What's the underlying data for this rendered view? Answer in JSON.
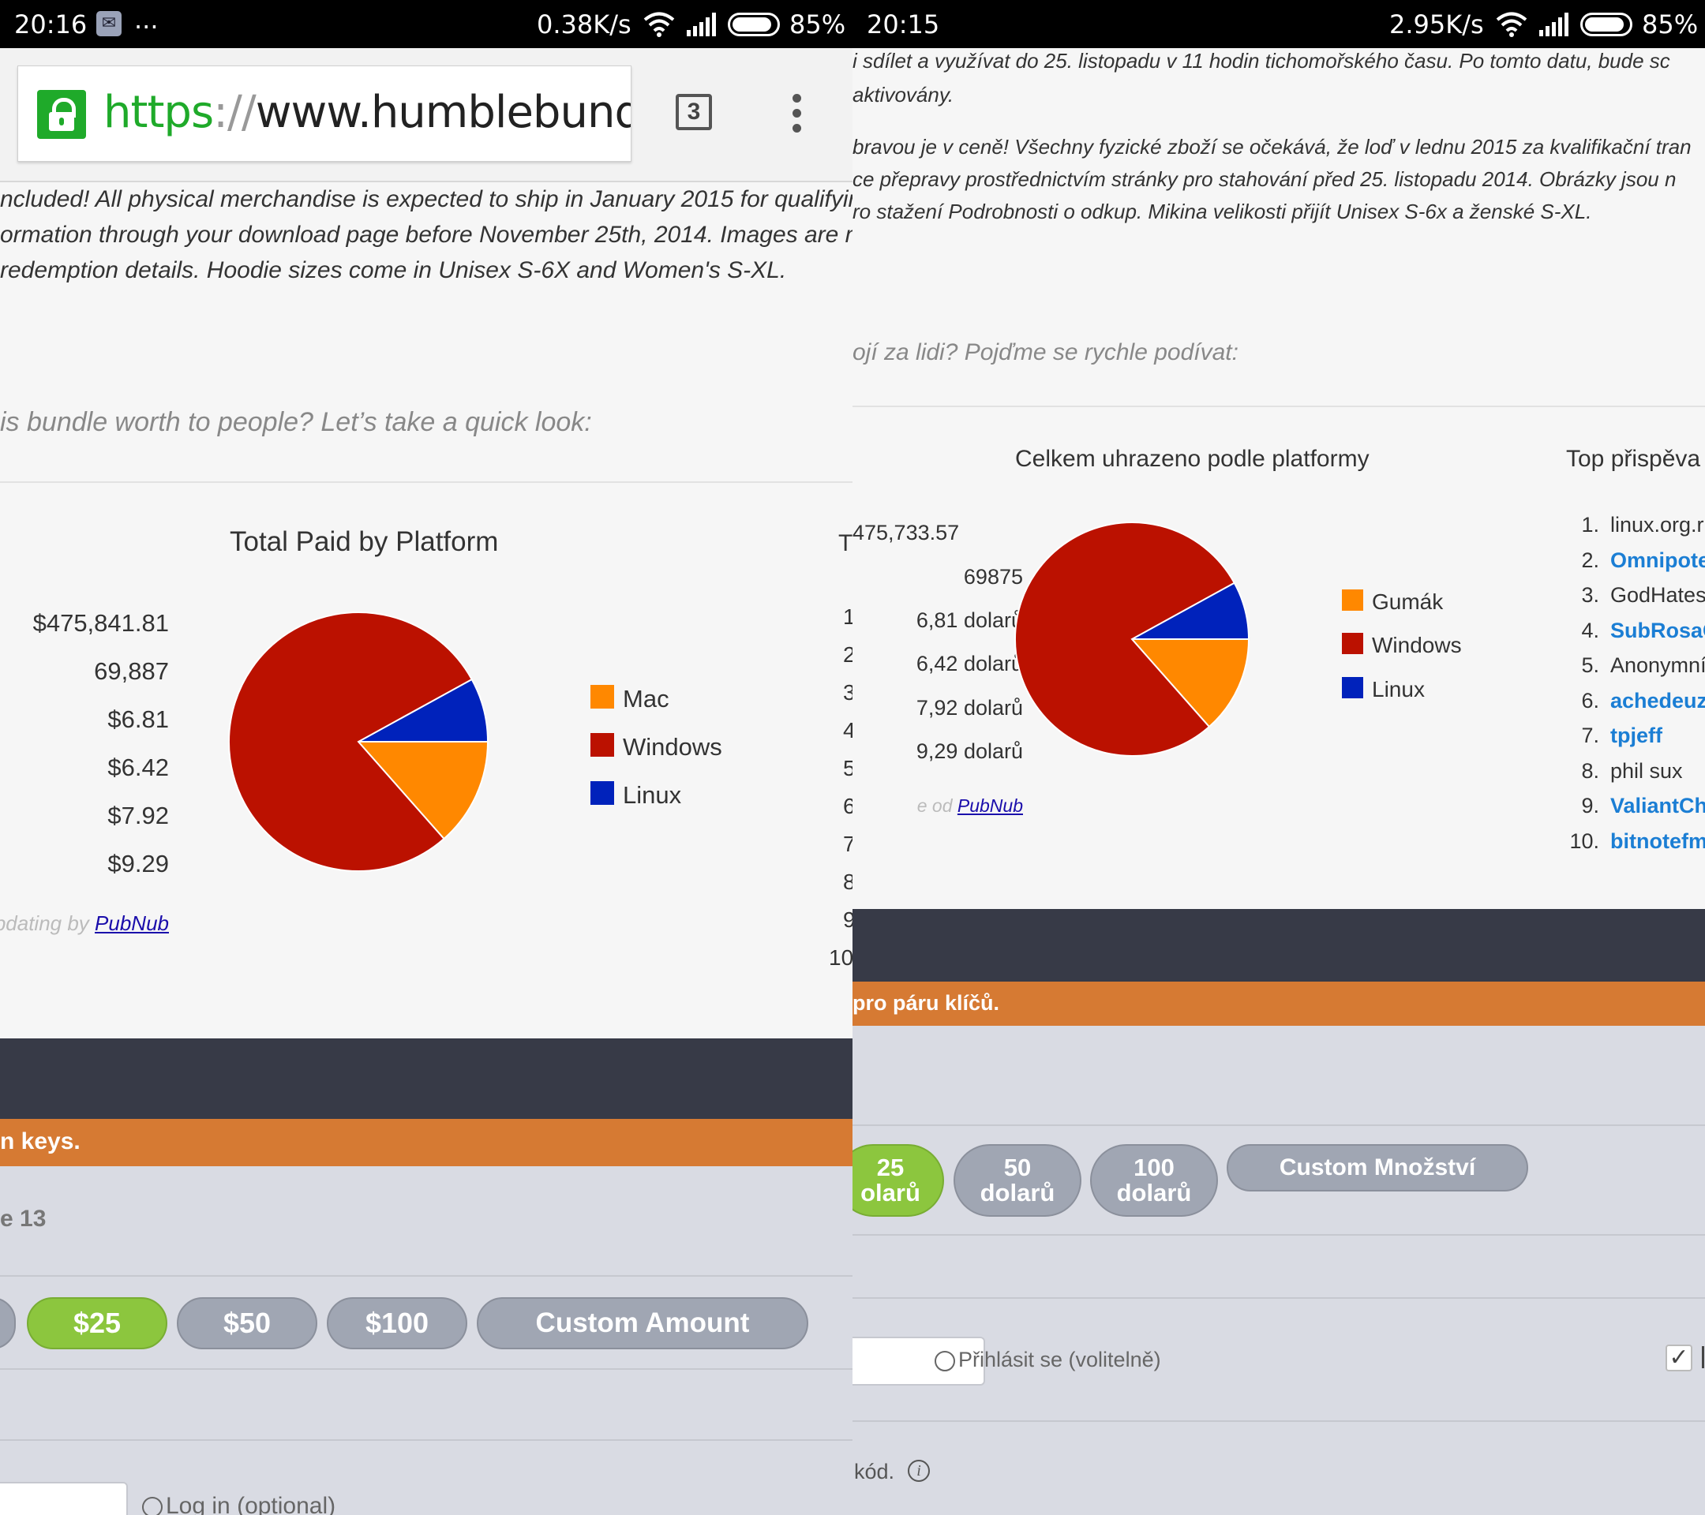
{
  "left": {
    "status": {
      "time": "20:16",
      "dots": "...",
      "speed": "0.38K/s",
      "battery": "85%"
    },
    "browser": {
      "url_scheme": "https",
      "url_sep": "://",
      "url_host": "www.humblebundle.c",
      "tab_count": "3"
    },
    "paragraph": [
      "ncluded! All physical merchandise is expected to ship in January 2015 for qualifyin",
      "ormation through your download page before November 25th, 2014. Images are m",
      "redemption details. Hoodie sizes come in Unisex S-6X and Women's S-XL."
    ],
    "question": "is bundle worth to people? Let’s take a quick look:",
    "stats": [
      "$475,841.81",
      "69,887",
      "$6.81",
      "$6.42",
      "$7.92",
      "$9.29"
    ],
    "chart_title": "Total Paid by Platform",
    "legend": [
      "Mac",
      "Windows",
      "Linux"
    ],
    "pubnub_prefix": "pdating by ",
    "pubnub_link": "PubNub",
    "right_numbers": [
      "T",
      "1",
      "2",
      "3",
      "4",
      "5",
      "6",
      "7",
      "8",
      "9",
      "10"
    ],
    "orange_bar": "n keys.",
    "grey_text": "e 13",
    "amounts": [
      "$25",
      "$50",
      "$100",
      "Custom Amount"
    ],
    "login": "Log in (optional)"
  },
  "right": {
    "status": {
      "time": "20:15",
      "speed": "2.95K/s",
      "battery": "85%"
    },
    "paragraph_top": [
      "i sdílet a využívat do 25. listopadu v 11 hodin tichomořského času. Po tomto datu, bude sc",
      "aktivovány."
    ],
    "paragraph_mid": [
      "bravou je v ceně! Všechny fyzické zboží se očekává, že loď v lednu 2015 za kvalifikační tran",
      "ce přepravy prostřednictvím stránky pro stahování před 25. listopadu 2014. Obrázky jsou n",
      "ro stažení Podrobnosti o odkup. Mikina velikosti přijít Unisex S-6x a ženské S-XL."
    ],
    "question": "ojí za lidi? Pojďme se rychle podívat:",
    "stats": [
      "475,733.57",
      "69875",
      "6,81 dolarů",
      "6,42 dolarů",
      "7,92 dolarů",
      "9,29 dolarů"
    ],
    "pubnub_prefix": "e od ",
    "pubnub_link": "PubNub",
    "chart_title": "Celkem uhrazeno podle platformy",
    "legend": [
      "Gumák",
      "Windows",
      "Linux"
    ],
    "top_title": "Top přispěva",
    "top_list": [
      {
        "n": "1.",
        "name": "linux.org.ru",
        "link": false
      },
      {
        "n": "2.",
        "name": "Omnipoten",
        "link": true
      },
      {
        "n": "3.",
        "name": "GodHates(",
        "link": false
      },
      {
        "n": "4.",
        "name": "SubRosaG",
        "link": true
      },
      {
        "n": "5.",
        "name": "Anonymní",
        "link": false
      },
      {
        "n": "6.",
        "name": "achedeuzc",
        "link": true
      },
      {
        "n": "7.",
        "name": "tpjeff",
        "link": true
      },
      {
        "n": "8.",
        "name": "phil sux",
        "link": false
      },
      {
        "n": "9.",
        "name": "ValiantChe",
        "link": true
      },
      {
        "n": "10.",
        "name": "bitnotefm",
        "link": true
      }
    ],
    "orange_bar": "pro páru klíčů.",
    "amounts": [
      {
        "l1": "25",
        "l2": "olarů"
      },
      {
        "l1": "50",
        "l2": "dolarů"
      },
      {
        "l1": "100",
        "l2": "dolarů"
      },
      {
        "l1": "Custom Množství",
        "l2": ""
      }
    ],
    "login": "Přihlásit se (volitelně)",
    "code_label": "kód.",
    "info_icon": "i"
  },
  "chart_data": [
    {
      "type": "pie",
      "title": "Total Paid by Platform",
      "categories": [
        "Mac",
        "Windows",
        "Linux"
      ],
      "values": [
        13.5,
        78.5,
        8.0
      ],
      "colors": [
        "#ff8800",
        "#bb1100",
        "#0022bb"
      ],
      "legend_position": "right"
    },
    {
      "type": "pie",
      "title": "Celkem uhrazeno podle platformy",
      "categories": [
        "Gumák",
        "Windows",
        "Linux"
      ],
      "values": [
        13.5,
        78.5,
        8.0
      ],
      "colors": [
        "#ff8800",
        "#bb1100",
        "#0022bb"
      ],
      "legend_position": "right"
    }
  ]
}
